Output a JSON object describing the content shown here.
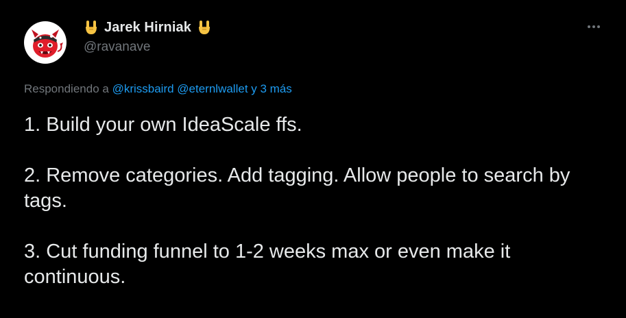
{
  "author": {
    "display_name": "Jarek Hirniak",
    "handle": "@ravanave",
    "emoji_left": "rock-on-hand",
    "emoji_right": "rock-on-hand"
  },
  "reply_context": {
    "prefix": "Respondiendo a",
    "mentions": [
      "@krissbaird",
      "@eternlwallet"
    ],
    "suffix": "y 3 más"
  },
  "body": {
    "paragraphs": [
      "1. Build your own IdeaScale ffs.",
      "2. Remove categories. Add tagging. Allow people to search by tags.",
      "3. Cut funding funnel to 1-2 weeks max or even make it continuous."
    ]
  },
  "icons": {
    "avatar": "red-devil-avatar",
    "more": "more-options-icon"
  },
  "colors": {
    "background": "#000000",
    "text": "#e7e9ea",
    "muted": "#71767b",
    "link": "#1d9bf0"
  }
}
